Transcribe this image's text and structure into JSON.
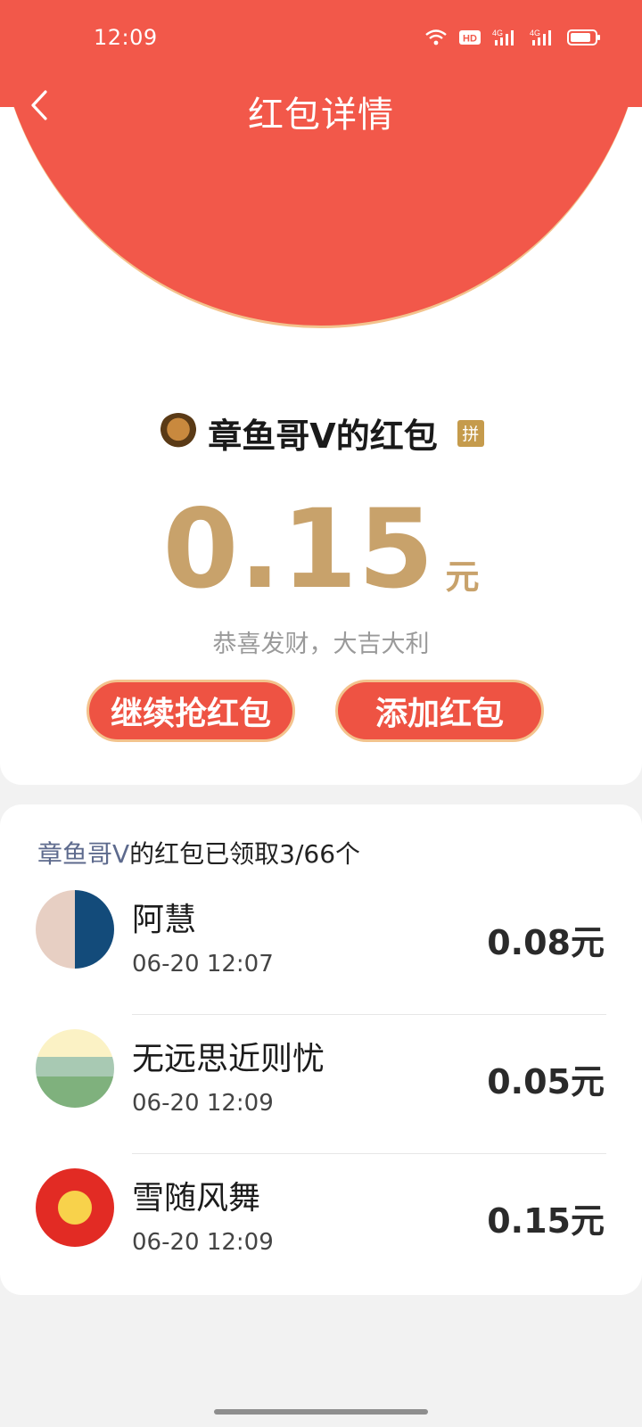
{
  "status_bar": {
    "time": "12:09",
    "icons": [
      "wifi-icon",
      "hd-icon",
      "signal-4g-icon",
      "signal-4g-icon",
      "battery-icon"
    ]
  },
  "nav": {
    "title": "红包详情",
    "back_icon": "chevron-left-icon"
  },
  "packet": {
    "sender": "章鱼哥V的红包",
    "pin_badge": "拼",
    "amount": "0.15",
    "unit": "元",
    "greeting": "恭喜发财，大吉大利"
  },
  "actions": {
    "continue_label": "继续抢红包",
    "add_label": "添加红包"
  },
  "summary": {
    "sender_name": "章鱼哥V",
    "text": "的红包已领取3/66个"
  },
  "records": [
    {
      "name": "阿慧",
      "time": "06-20 12:07",
      "amount": "0.08",
      "unit": "元"
    },
    {
      "name": "无远思近则忧",
      "time": "06-20 12:09",
      "amount": "0.05",
      "unit": "元"
    },
    {
      "name": "雪随风舞",
      "time": "06-20 12:09",
      "amount": "0.15",
      "unit": "元"
    }
  ],
  "colors": {
    "header_red": "#f2584a",
    "gold": "#c8a26b",
    "button_red": "#ee5343",
    "button_border": "#f3c38d"
  }
}
